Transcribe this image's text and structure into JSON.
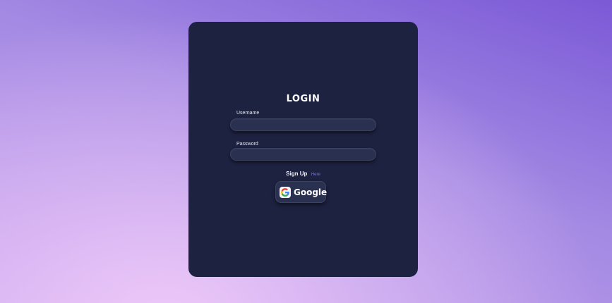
{
  "login": {
    "title": "LOGIN",
    "username": {
      "label": "Username",
      "value": "",
      "placeholder": ""
    },
    "password": {
      "label": "Password",
      "value": "",
      "placeholder": ""
    },
    "signup": {
      "text": "Sign Up",
      "link": "Here"
    },
    "google_button": {
      "label": "Google",
      "icon": "google-icon"
    }
  },
  "colors": {
    "card_background": "#1d2240",
    "input_background": "#2a3150",
    "link": "#7d72ea",
    "background_top": "#7b59d6",
    "background_glow": "#ecc8f8"
  }
}
